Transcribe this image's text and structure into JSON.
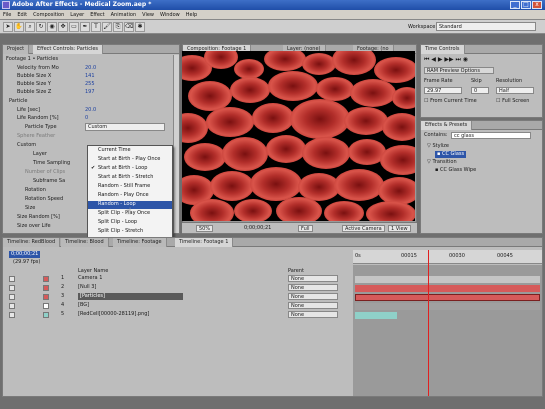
{
  "window": {
    "title": "Adobe After Effects - Medical Zoom.aep *",
    "min": "_",
    "max": "□",
    "close": "x"
  },
  "menu": [
    "File",
    "Edit",
    "Composition",
    "Layer",
    "Effect",
    "Animation",
    "View",
    "Window",
    "Help"
  ],
  "toolbar": {
    "workspace_label": "Workspace:",
    "workspace_value": "Standard"
  },
  "effect_controls": {
    "tabs": [
      "Project",
      "Effect Controls: Particles"
    ],
    "header": "Footage 1 • Particles",
    "rows": [
      {
        "name": "Velocity from Mo",
        "value": "20.0"
      },
      {
        "name": "Bubble Size X",
        "value": "141"
      },
      {
        "name": "Bubble Size Y",
        "value": "255"
      },
      {
        "name": "Bubble Size Z",
        "value": "197"
      },
      {
        "name": "Particle",
        "value": ""
      },
      {
        "name": "Life [sec]",
        "value": "20.0"
      },
      {
        "name": "Life Random [%]",
        "value": "0"
      },
      {
        "name": "Particle Type",
        "value": "Custom"
      },
      {
        "name": "Sphere Feather",
        "value": ""
      },
      {
        "name": "Custom",
        "value": ""
      },
      {
        "name": "Layer",
        "value": ""
      },
      {
        "name": "Time Sampling",
        "value": ""
      },
      {
        "name": "Number of Clips",
        "value": ""
      },
      {
        "name": "Subframe Sa",
        "value": ""
      },
      {
        "name": "Rotation",
        "value": ""
      },
      {
        "name": "Rotation Speed",
        "value": ""
      },
      {
        "name": "Size",
        "value": ""
      },
      {
        "name": "Size Random [%]",
        "value": ""
      },
      {
        "name": "Size over Life",
        "value": ""
      }
    ]
  },
  "dropdown": {
    "items": [
      "Current Time",
      "Start at Birth - Play Once",
      "Start at Birth - Loop",
      "Start at Birth - Stretch",
      "Random - Still Frame",
      "Random - Play Once",
      "Random - Loop",
      "Split Clip - Play Once",
      "Split Clip - Loop",
      "Split Clip - Stretch"
    ],
    "checked_index": 2,
    "highlighted_index": 6
  },
  "composition": {
    "tabs": [
      "Composition: Footage 1",
      "Layer: (none)",
      "Footage: (no"
    ],
    "zoom": "50%",
    "timecode": "0;00;00;21",
    "resolution": "Full",
    "camera": "Active Camera",
    "views": "1 View"
  },
  "time_controls": {
    "title": "Time Controls",
    "preview": "RAM Preview Options",
    "frame_rate_label": "Frame Rate",
    "frame_rate": "29.97",
    "skip_label": "Skip",
    "skip": "0",
    "resolution_label": "Resolution",
    "resolution": "Half",
    "from_current": "From Current Time",
    "full_screen": "Full Screen"
  },
  "effects_presets": {
    "title": "Effects & Presets",
    "contains_label": "Contains:",
    "search": "cc glass",
    "items": [
      {
        "name": "Stylize",
        "type": "folder"
      },
      {
        "name": "CC Glass",
        "type": "effect"
      },
      {
        "name": "Transition",
        "type": "folder"
      },
      {
        "name": "CC Glass Wipe",
        "type": "effect"
      }
    ]
  },
  "timeline": {
    "tabs": [
      "Timeline: RedBlood",
      "Timeline: Blood",
      "Timeline: Footage",
      "Timeline: Footage 1"
    ],
    "timecode": "0;00;00;21",
    "fps": "(29.97 fps)",
    "col_layer": "Layer Name",
    "col_parent": "Parent",
    "ticks": [
      "0s",
      "00015",
      "00030",
      "00045"
    ],
    "layers": [
      {
        "num": "1",
        "name": "Camera 1",
        "parent": "None",
        "color": "#d65a5a"
      },
      {
        "num": "2",
        "name": "[Null 3]",
        "parent": "None",
        "color": "#d65a5a"
      },
      {
        "num": "3",
        "name": "[Particles]",
        "parent": "None",
        "color": "#d65a5a"
      },
      {
        "num": "4",
        "name": "[BG]",
        "parent": "None",
        "color": "#ffffff"
      },
      {
        "num": "5",
        "name": "[RedCell[00000-28119].png]",
        "parent": "None",
        "color": "#8fd0c8"
      }
    ]
  },
  "colors": {
    "accent_blue": "#2d55a8",
    "layer_red": "#d65a5a",
    "layer_teal": "#8fd0c8",
    "playhead": "#e02020"
  }
}
